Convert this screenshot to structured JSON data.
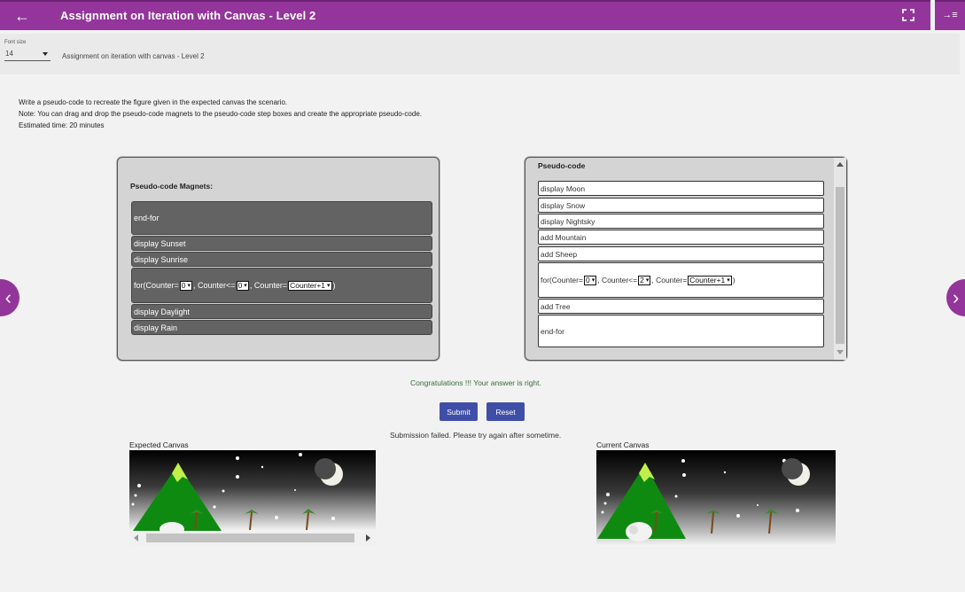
{
  "header": {
    "title": "Assignment on Iteration with Canvas - Level 2",
    "back_icon": "←",
    "right_icon": "→≡"
  },
  "fontbar": {
    "label": "Font size",
    "value": "14",
    "subtitle": "Assignment on iteration with canvas - Level 2"
  },
  "instructions": {
    "line1": "Write a pseudo-code to recreate the figure given in the expected canvas the scenario.",
    "line2": "Note: You can drag and drop the pseudo-code magnets to the pseudo-code step boxes and create the appropriate pseudo-code.",
    "line3": "Estimated time: 20 minutes"
  },
  "magnets": {
    "title": "Pseudo-code Magnets:",
    "end_for": "end-for",
    "sunset": "display Sunset",
    "sunrise": "display Sunrise",
    "daylight": "display Daylight",
    "rain": "display Rain",
    "for_loop": {
      "prefix": "for(Counter=",
      "init": "0",
      "cond_label": ", Counter<=",
      "limit": "0",
      "step_label": ", Counter=",
      "step": "Counter+1",
      "suffix": ")"
    }
  },
  "pseudocode": {
    "title": "Pseudo-code",
    "moon": "display Moon",
    "snow": "display Snow",
    "nightsky": "display Nightsky",
    "mountain": "add Mountain",
    "sheep": "add Sheep",
    "tree": "add Tree",
    "end_for": "end-for",
    "for_loop": {
      "prefix": "for(Counter=",
      "init": "0",
      "cond_label": ", Counter<=",
      "limit": "2",
      "step_label": ", Counter=",
      "step": "Counter+1",
      "suffix": ")"
    }
  },
  "feedback": {
    "success": "Congratulations !!! Your answer is right.",
    "failure": "Submission failed. Please try again after sometime."
  },
  "buttons": {
    "submit": "Submit",
    "reset": "Reset"
  },
  "canvases": {
    "expected": "Expected Canvas",
    "current": "Current Canvas"
  },
  "colors": {
    "header": "#93359a",
    "button": "#3f4fa8",
    "magnet": "#636363"
  }
}
